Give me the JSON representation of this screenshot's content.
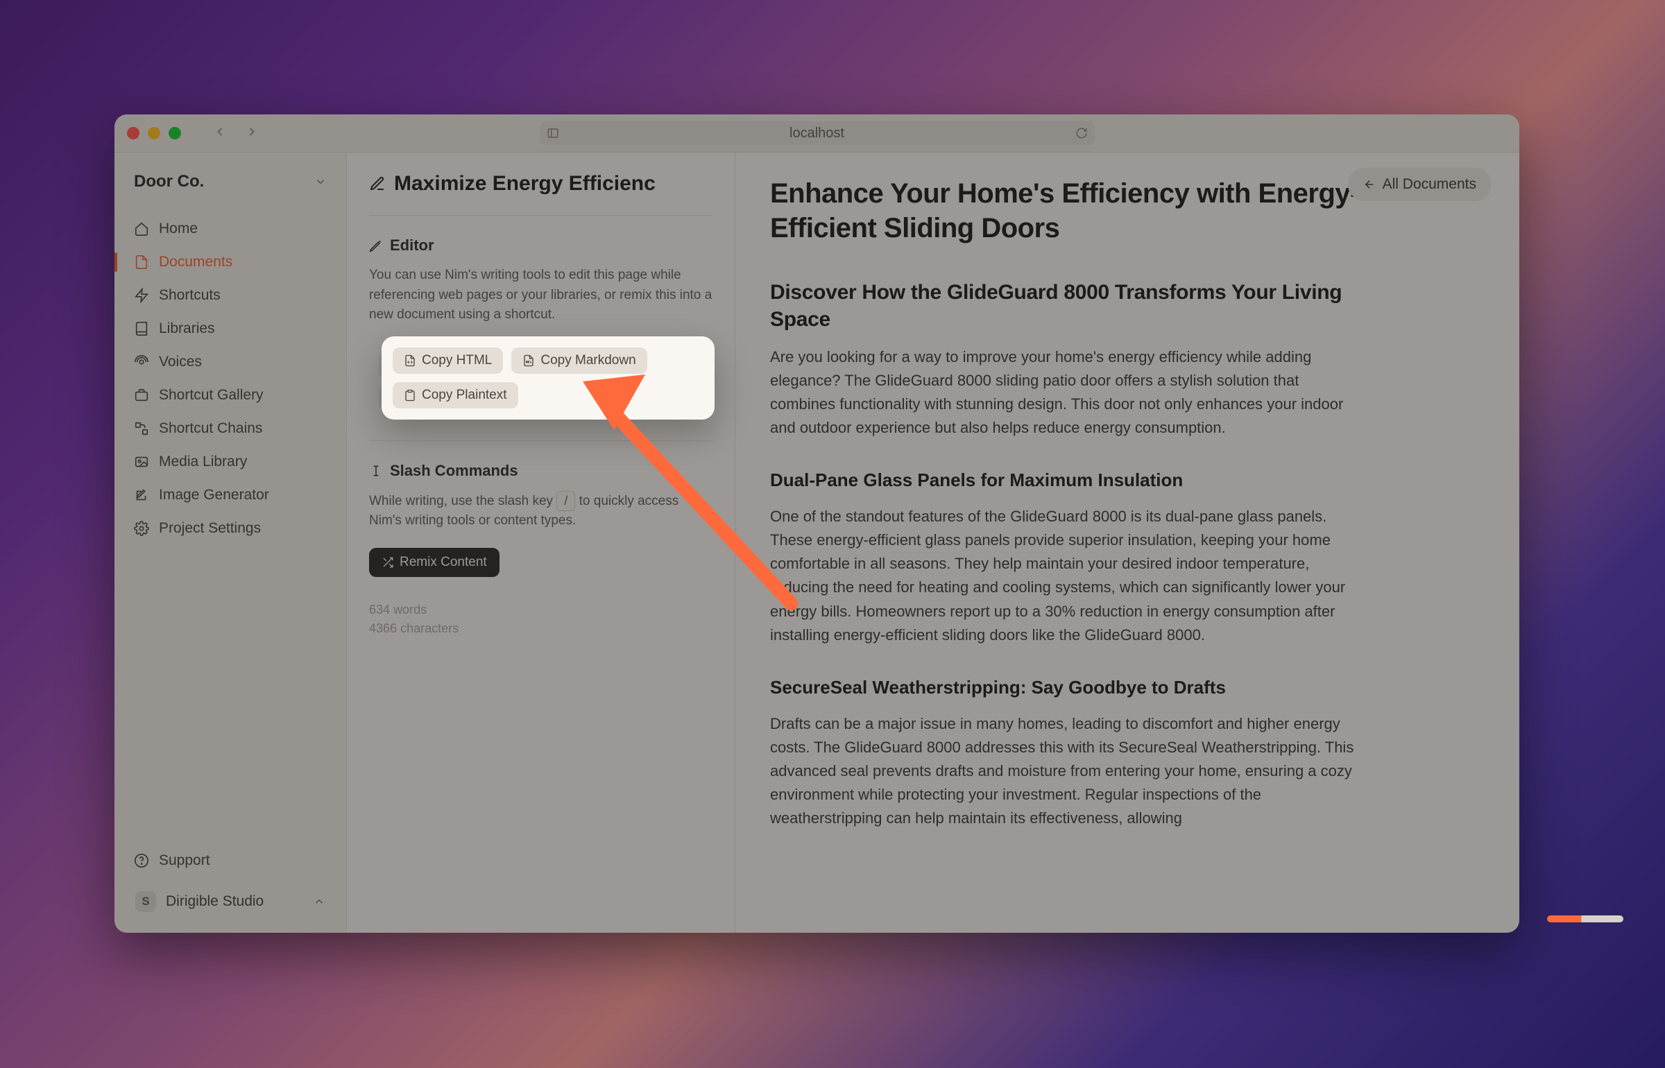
{
  "browser": {
    "address": "localhost"
  },
  "workspace": {
    "name": "Door Co."
  },
  "sidebar": {
    "items": [
      {
        "label": "Home",
        "icon": "home-icon"
      },
      {
        "label": "Documents",
        "icon": "documents-icon",
        "active": true
      },
      {
        "label": "Shortcuts",
        "icon": "shortcuts-icon"
      },
      {
        "label": "Libraries",
        "icon": "libraries-icon"
      },
      {
        "label": "Voices",
        "icon": "voices-icon"
      },
      {
        "label": "Shortcut Gallery",
        "icon": "gallery-icon"
      },
      {
        "label": "Shortcut Chains",
        "icon": "chains-icon"
      },
      {
        "label": "Media Library",
        "icon": "media-icon"
      },
      {
        "label": "Image Generator",
        "icon": "image-gen-icon"
      },
      {
        "label": "Project Settings",
        "icon": "settings-icon"
      }
    ],
    "support_label": "Support",
    "studio": {
      "initial": "S",
      "name": "Dirigible Studio"
    }
  },
  "editor": {
    "doc_title": "Maximize Energy Efficienc",
    "editor_heading": "Editor",
    "editor_desc": "You can use Nim's writing tools to edit this page while referencing web pages or your libraries, or remix this into a new document using a shortcut.",
    "copy_buttons": {
      "html": "Copy HTML",
      "markdown": "Copy Markdown",
      "plaintext": "Copy Plaintext"
    },
    "slash_heading": "Slash Commands",
    "slash_desc_pre": "While writing, use the slash key ",
    "slash_key": "/",
    "slash_desc_post": " to quickly access Nim's writing tools or content types.",
    "remix_label": "Remix Content",
    "stats": {
      "words_n": "634",
      "words_l": "words",
      "chars_n": "4366",
      "chars_l": "characters"
    }
  },
  "header": {
    "all_docs": "All Documents"
  },
  "article": {
    "h1": "Enhance Your Home's Efficiency with Energy-Efficient Sliding Doors",
    "h2": "Discover How the GlideGuard 8000 Transforms Your Living Space",
    "p1": "Are you looking for a way to improve your home's energy efficiency while adding elegance? The GlideGuard 8000 sliding patio door offers a stylish solution that combines functionality with stunning design. This door not only enhances your indoor and outdoor experience but also helps reduce energy consumption.",
    "h3a": "Dual-Pane Glass Panels for Maximum Insulation",
    "p2": "One of the standout features of the GlideGuard 8000 is its dual-pane glass panels. These energy-efficient glass panels provide superior insulation, keeping your home comfortable in all seasons. They help maintain your desired indoor temperature, reducing the need for heating and cooling systems, which can significantly lower your energy bills. Homeowners report up to a 30% reduction in energy consumption after installing energy-efficient sliding doors like the GlideGuard 8000.",
    "h3b": "SecureSeal Weatherstripping: Say Goodbye to Drafts",
    "p3": "Drafts can be a major issue in many homes, leading to discomfort and higher energy costs. The GlideGuard 8000 addresses this with its SecureSeal Weatherstripping. This advanced seal prevents drafts and moisture from entering your home, ensuring a cozy environment while protecting your investment. Regular inspections of the weatherstripping can help maintain its effectiveness, allowing"
  }
}
